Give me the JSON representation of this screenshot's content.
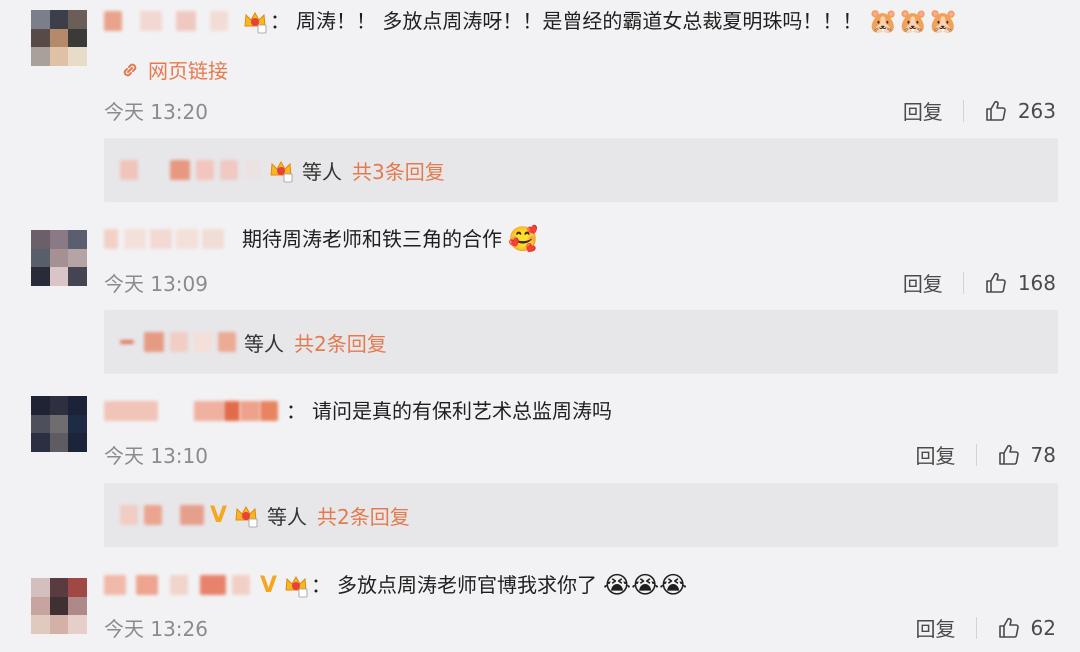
{
  "comments": [
    {
      "separator": "：",
      "text": "周涛！！ 多放点周涛呀！！是曾经的霸道女总裁夏明珠吗！！！",
      "trailing_emoji": "🐹🐹🐹",
      "link": "网页链接",
      "time": "今天 13:20",
      "reply": "回复",
      "likes": "263",
      "sub_etc": "等人",
      "sub_total": "共3条回复",
      "avatar": [
        "#7a7f8a",
        "#3c3f49",
        "#6b5e57",
        "#584b45",
        "#b48a6b",
        "#3b3a3a",
        "#a7a19a",
        "#dfc1a5",
        "#e8dcc8"
      ]
    },
    {
      "separator": "",
      "text": "期待周涛老师和铁三角的合作",
      "trailing_emoji": "🥰",
      "time": "今天 13:09",
      "reply": "回复",
      "likes": "168",
      "sub_etc": "等人",
      "sub_total": "共2条回复",
      "avatar": [
        "#6b6069",
        "#8a7a86",
        "#5b5e6e",
        "#595e6b",
        "#a59094",
        "#b6a3a5",
        "#2a2b39",
        "#d9c4c8",
        "#454454"
      ]
    },
    {
      "separator": "：",
      "text": "请问是真的有保利艺术总监周涛吗",
      "trailing_emoji": "",
      "time": "今天 13:10",
      "reply": "回复",
      "likes": "78",
      "sub_etc": "等人",
      "sub_total": "共2条回复",
      "avatar": [
        "#1f2333",
        "#2e3040",
        "#1c2338",
        "#4d4f5a",
        "#6f6d6e",
        "#1d2c44",
        "#2b2f42",
        "#5e5b62",
        "#1b2438"
      ]
    },
    {
      "separator": "：",
      "text": "多放点周涛老师官博我求你了",
      "trailing_emoji": "😭😭😭",
      "time": "今天 13:26",
      "reply": "回复",
      "likes": "62",
      "avatar": [
        "#d4bfbf",
        "#5a3b3f",
        "#a14744",
        "#c7a4a0",
        "#3f3034",
        "#ad8a87",
        "#e0cabf",
        "#d3b1a7",
        "#e7cfc9"
      ]
    }
  ]
}
